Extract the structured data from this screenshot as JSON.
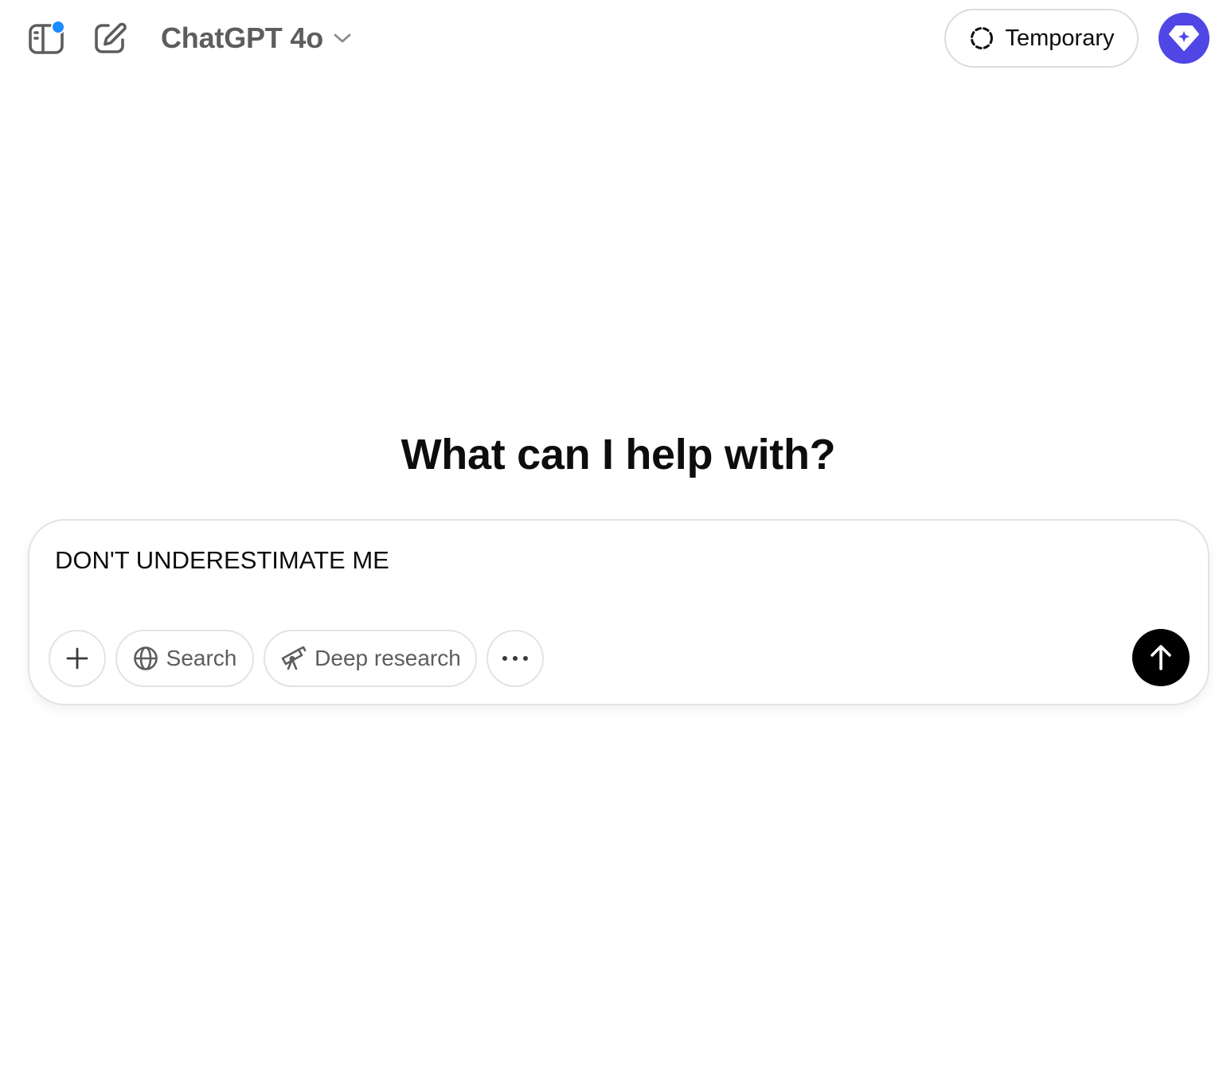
{
  "header": {
    "model_name": "ChatGPT 4o",
    "temporary_label": "Temporary"
  },
  "icons": {
    "sidebar_toggle": "sidebar-toggle-icon",
    "notification_dot": "notification-dot",
    "new_chat": "new-chat-icon",
    "model_dropdown": "chevron-down-icon",
    "temporary": "dashed-circle-icon",
    "upgrade": "diamond-sparkle-icon",
    "attach": "plus-icon",
    "search": "globe-icon",
    "deep_research": "telescope-icon",
    "more": "ellipsis-icon",
    "send": "arrow-up-icon"
  },
  "main": {
    "heading": "What can I help with?"
  },
  "composer": {
    "input_value": "DON'T UNDERESTIMATE ME",
    "search_label": "Search",
    "deep_research_label": "Deep research"
  },
  "colors": {
    "accent_upgrade": "#4f46e5",
    "notification_dot": "#1a8cff",
    "send_button": "#000000",
    "border": "#e3e3e3",
    "muted_text": "#5d5d5d"
  }
}
